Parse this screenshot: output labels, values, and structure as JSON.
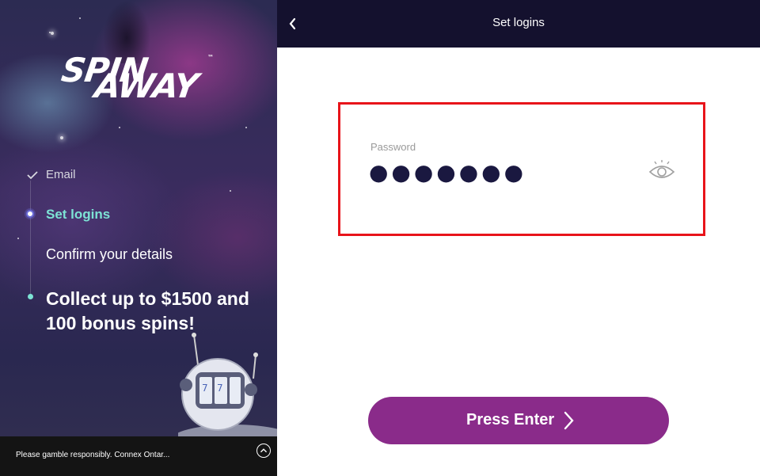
{
  "sidebar": {
    "logo": {
      "line1": "SPIN",
      "line2": "AWAY",
      "tm": "™"
    },
    "steps": [
      {
        "label": "Email",
        "status": "done",
        "icon": "check-icon"
      },
      {
        "label": "Set logins",
        "status": "active"
      },
      {
        "label": "Confirm your details",
        "status": "pending"
      },
      {
        "label": "Collect up to $1500 and 100 bonus spins!",
        "status": "reward"
      }
    ],
    "footer": {
      "text": "Please gamble responsibly. Connex Ontar..."
    }
  },
  "header": {
    "title": "Set logins",
    "back_icon": "chevron-left-icon"
  },
  "form": {
    "password": {
      "label": "Password",
      "value": "●●●●●●●",
      "toggle_icon": "eye-icon"
    }
  },
  "submit": {
    "label": "Press Enter",
    "icon": "chevron-right-icon"
  },
  "colors": {
    "accent_teal": "#7de3d5",
    "button_purple": "#8a2b8a",
    "header_bg": "#14112e",
    "highlight_red": "#e8141a"
  }
}
